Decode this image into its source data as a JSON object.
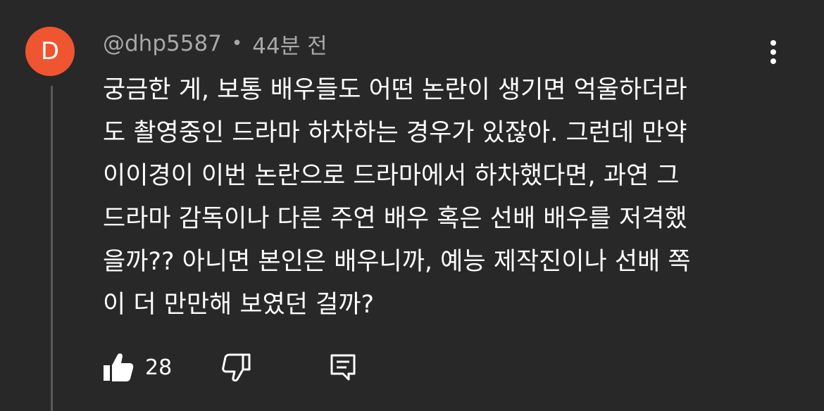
{
  "comment": {
    "avatar_letter": "D",
    "avatar_color": "#ef5530",
    "author": "@dhp5587",
    "separator": "•",
    "timestamp": "44분 전",
    "text_lines": [
      "궁금한 게, 보통 배우들도 어떤 논란이 생기면 억울하더라",
      "도 촬영중인 드라마 하차하는 경우가 있잖아. 그런데 만약",
      "이이경이 이번 논란으로 드라마에서 하차했다면, 과연 그",
      "드라마 감독이나 다른 주연 배우 혹은 선배 배우를 저격했",
      "을까?? 아니면 본인은 배우니까, 예능 제작진이나 선배 쪽",
      "이 더 만만해 보였던 걸까?"
    ],
    "like_count": "28",
    "icons": {
      "menu": "more-vert-icon",
      "like": "thumbs-up-icon",
      "dislike": "thumbs-down-icon",
      "reply": "reply-icon"
    }
  }
}
